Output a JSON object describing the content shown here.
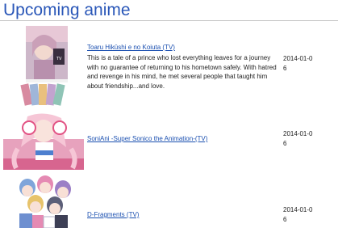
{
  "page": {
    "title": "Upcoming anime"
  },
  "items": [
    {
      "title": "Toaru Hikūshi e no Koiuta (TV)",
      "synopsis": "This is a tale of a prince who lost everything leaves for a journey with no guarantee of returning to his hometown safely. With hatred and revenge in his mind, he met several people that taught him about friendship...and love.",
      "date": "2014-01-06",
      "cover_alt": "Toaru Hikūshi e no Koiuta cover"
    },
    {
      "title": "SoniAni -Super Sonico the Animation-(TV)",
      "synopsis": "",
      "date": "2014-01-06",
      "cover_alt": "SoniAni cover"
    },
    {
      "title": "D-Fragments (TV)",
      "synopsis": "",
      "date": "2014-01-06",
      "cover_alt": "D-Fragments cover"
    }
  ],
  "colors": {
    "title": "#2a57b8",
    "link": "#1a4fb0",
    "text": "#222222",
    "rule": "#c8c8c8"
  }
}
